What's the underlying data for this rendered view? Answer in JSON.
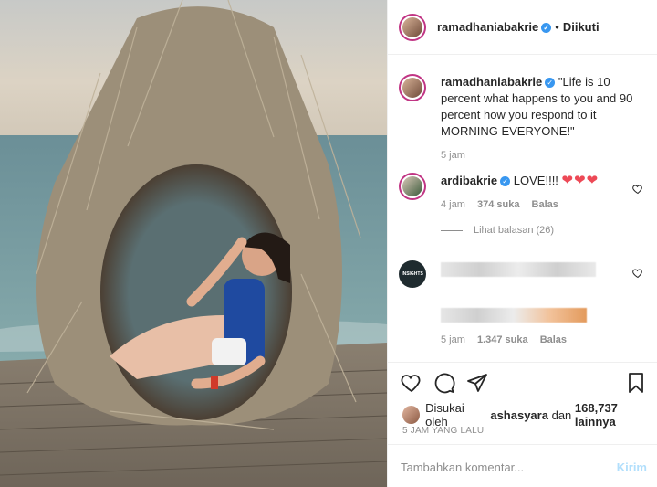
{
  "header": {
    "username": "ramadhaniabakrie",
    "separator": "•",
    "follow_status": "Diikuti"
  },
  "caption": {
    "username": "ramadhaniabakrie",
    "text": "\"Life is 10 percent what happens to you and 90 percent how you respond to it MORNING EVERYONE!\"",
    "time": "5 jam"
  },
  "comments": [
    {
      "username": "ardibakrie",
      "text": "LOVE!!!!",
      "emoji": "❤❤❤",
      "time": "4 jam",
      "likes": "374 suka",
      "reply": "Balas",
      "view_replies": "Lihat balasan (26)",
      "avatar_text": ""
    },
    {
      "username": "",
      "text": "",
      "time": "5 jam",
      "likes": "1.347 suka",
      "reply": "Balas",
      "avatar_text": "INSIGHTS"
    }
  ],
  "likes_line": {
    "prefix": "Disukai oleh",
    "user": "ashasyara",
    "middle": "dan",
    "count": "168,737 lainnya"
  },
  "timestamp": "5 JAM YANG LALU",
  "comment_box": {
    "placeholder": "Tambahkan komentar...",
    "send_label": "Kirim"
  },
  "colors": {
    "verified": "#3897f0",
    "heart": "#ed4956",
    "send_disabled": "#b2dffc"
  }
}
